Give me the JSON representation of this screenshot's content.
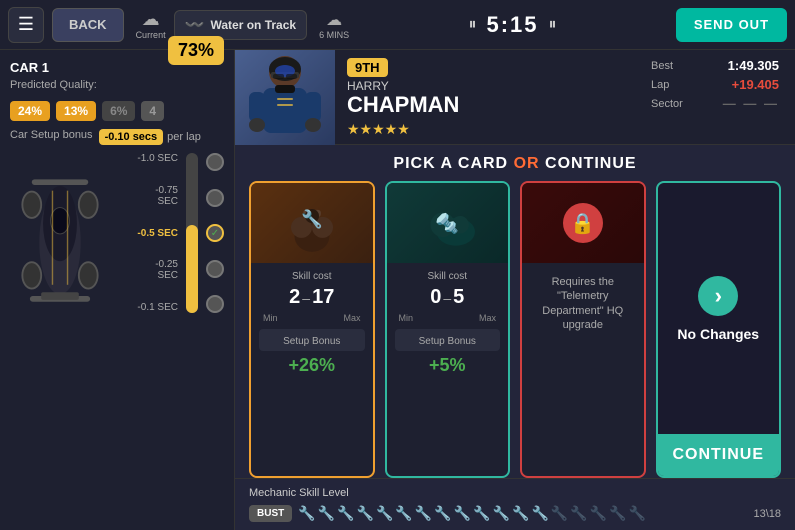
{
  "nav": {
    "back_label": "BACK",
    "weather_current_label": "Current",
    "weather_track_label": "Water on Track",
    "weather_next_mins": "6 MINS",
    "timer": "5:15",
    "send_out_label": "SEND OUT"
  },
  "left_panel": {
    "car_title": "CAR 1",
    "predicted_quality_label": "Predicted Quality:",
    "quality_percent": "73%",
    "stats": [
      "24%",
      "13%",
      "6%",
      "4"
    ],
    "setup_bonus_label": "Car Setup bonus",
    "setup_bonus_value": "-0.10 secs",
    "per_lap": "per lap",
    "slider_labels": [
      "-1.0 SEC",
      "-0.75 SEC",
      "-0.5 SEC",
      "-0.25 SEC",
      "-0.1 SEC"
    ],
    "selected_slider": "-0.5 SEC"
  },
  "driver": {
    "position": "9TH",
    "firstname": "HARRY",
    "lastname": "CHAPMAN",
    "stars": 5,
    "best_label": "Best",
    "best_value": "1:49.305",
    "lap_label": "Lap",
    "lap_value": "+19.405",
    "sector_label": "Sector",
    "sector_value": "— — —"
  },
  "pick_header": {
    "text_before": "PICK A CARD",
    "or_text": "OR",
    "text_after": "CONTINUE"
  },
  "cards": [
    {
      "id": "card1",
      "type": "orange",
      "image_emoji": "🔧",
      "skill_cost_label": "Skill cost",
      "skill_min": "2",
      "skill_max": "17",
      "min_label": "Min",
      "max_label": "Max",
      "setup_bonus_label": "Setup Bonus",
      "setup_bonus_value": "+26%"
    },
    {
      "id": "card2",
      "type": "teal",
      "image_emoji": "🔩",
      "skill_cost_label": "Skill cost",
      "skill_min": "0",
      "skill_max": "5",
      "min_label": "Min",
      "max_label": "Max",
      "setup_bonus_label": "Setup Bonus",
      "setup_bonus_value": "+5%"
    },
    {
      "id": "card3",
      "type": "red",
      "image_emoji": "🔒",
      "locked_text": "Requires the \"Telemetry Department\" HQ upgrade"
    },
    {
      "id": "card4",
      "type": "nochanges",
      "no_changes_label": "No Changes",
      "continue_label": "CONTINUE"
    }
  ],
  "mechanic": {
    "label": "Mechanic Skill Level",
    "bust_label": "BUST",
    "active_wrenches": 13,
    "total_wrenches": 18,
    "count_label": "13\\18"
  }
}
